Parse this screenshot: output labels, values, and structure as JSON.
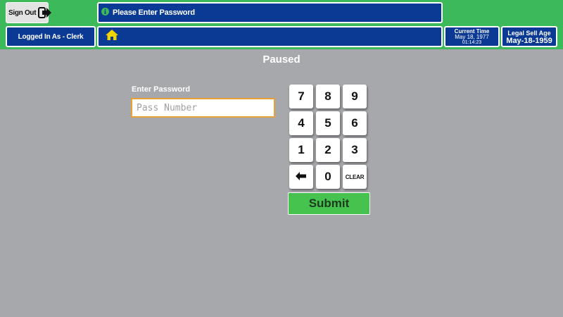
{
  "header": {
    "sign_out_label": "Sign Out",
    "message": "Please Enter Password",
    "logged_in": "Logged In As - Clerk",
    "current_time": {
      "label": "Current Time",
      "date": "May 18, 1977",
      "time": "01:14:23"
    },
    "legal_age": {
      "label": "Legal Sell Age",
      "date": "May-18-1959"
    }
  },
  "main": {
    "status": "Paused",
    "password_label": "Enter Password",
    "password_placeholder": "Pass Number",
    "password_value": "",
    "keypad": [
      "7",
      "8",
      "9",
      "4",
      "5",
      "6",
      "1",
      "2",
      "3",
      "←",
      "0",
      "CLEAR"
    ],
    "submit_label": "Submit"
  },
  "colors": {
    "topbar": "#3cb95a",
    "header_blue": "#0b3a95",
    "background": "#a7a8ac",
    "input_border": "#e8a038",
    "submit": "#46c24f",
    "home_icon": "#f2d400",
    "info_icon": "#3cb95a"
  },
  "icons": {
    "sign_out": "sign-out-arrow-icon",
    "info": "info-icon",
    "home": "home-icon",
    "backspace": "backspace-arrow-icon"
  }
}
